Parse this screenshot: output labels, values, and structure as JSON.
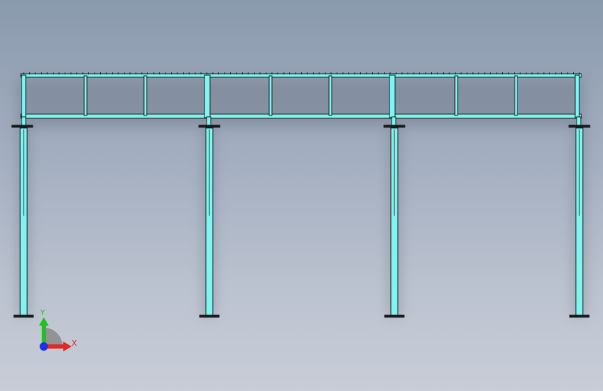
{
  "viewport": {
    "view_name": "Front",
    "background_gradient": [
      "#8a9aad",
      "#c8cdd7"
    ]
  },
  "model": {
    "description_colors": {
      "member_fill": "#7ff5f2",
      "member_edge": "#1a1a1a",
      "shadow": "#5d6675"
    },
    "bays": 3,
    "columns": 4,
    "truss_panels_per_bay": 3
  },
  "triad": {
    "x_label": "X",
    "y_label": "Y",
    "x_color": "#e32626",
    "y_color": "#1fc21f",
    "z_color": "#1b32e8"
  }
}
